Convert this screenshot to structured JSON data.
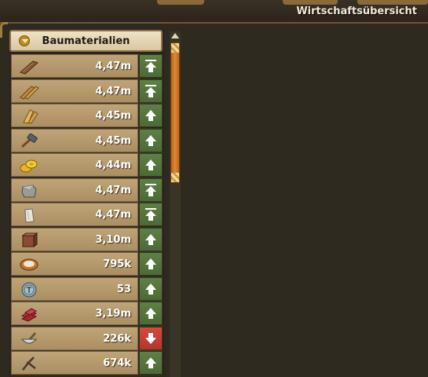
{
  "window": {
    "title": "Wirtschaftsübersicht"
  },
  "category": {
    "label": "Baumaterialien",
    "dropdown_icon": "dropdown-arrow-icon"
  },
  "resources": [
    {
      "icon": "plank-icon",
      "value": "4,47m",
      "trend": "up-max"
    },
    {
      "icon": "hardwood-plank-icon",
      "value": "4,47m",
      "trend": "up-max"
    },
    {
      "icon": "exotic-plank-icon",
      "value": "4,45m",
      "trend": "up"
    },
    {
      "icon": "hammer-tool-icon",
      "value": "4,45m",
      "trend": "up"
    },
    {
      "icon": "gold-coins-icon",
      "value": "4,44m",
      "trend": "up"
    },
    {
      "icon": "stone-icon",
      "value": "4,47m",
      "trend": "up-max"
    },
    {
      "icon": "marble-icon",
      "value": "4,47m",
      "trend": "up-max"
    },
    {
      "icon": "granite-icon",
      "value": "3,10m",
      "trend": "up"
    },
    {
      "icon": "mortar-bowl-icon",
      "value": "795k",
      "trend": "up"
    },
    {
      "icon": "silver-coin-icon",
      "value": "53",
      "trend": "up"
    },
    {
      "icon": "bricks-icon",
      "value": "3,19m",
      "trend": "up"
    },
    {
      "icon": "mortar-pestle-icon",
      "value": "226k",
      "trend": "down"
    },
    {
      "icon": "pliers-icon",
      "value": "674k",
      "trend": "up"
    }
  ],
  "colors": {
    "trend_up": "#56763e",
    "trend_down": "#c83c31",
    "scroll_thumb": "#d07a24"
  }
}
